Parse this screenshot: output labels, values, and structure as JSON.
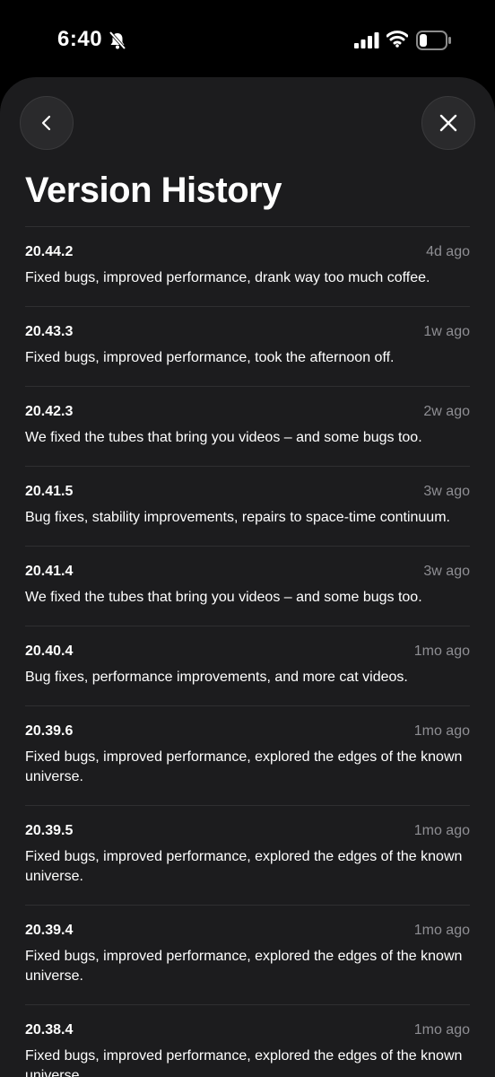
{
  "status_bar": {
    "time": "6:40",
    "icons": [
      "bell-slash-icon",
      "signal-icon",
      "wifi-icon",
      "battery-icon"
    ]
  },
  "header": {
    "back_icon": "chevron-left-icon",
    "close_icon": "close-icon",
    "title": "Version History"
  },
  "versions": [
    {
      "version": "20.44.2",
      "age": "4d ago",
      "notes": "Fixed bugs, improved performance, drank way too much coffee."
    },
    {
      "version": "20.43.3",
      "age": "1w ago",
      "notes": "Fixed bugs, improved performance, took the afternoon off."
    },
    {
      "version": "20.42.3",
      "age": "2w ago",
      "notes": "We fixed the tubes that bring you videos – and some bugs too."
    },
    {
      "version": "20.41.5",
      "age": "3w ago",
      "notes": "Bug fixes, stability improvements, repairs to space-time continuum."
    },
    {
      "version": "20.41.4",
      "age": "3w ago",
      "notes": "We fixed the tubes that bring you videos – and some bugs too."
    },
    {
      "version": "20.40.4",
      "age": "1mo ago",
      "notes": "Bug fixes, performance improvements, and more cat videos."
    },
    {
      "version": "20.39.6",
      "age": "1mo ago",
      "notes": "Fixed bugs, improved performance, explored the edges of the known universe."
    },
    {
      "version": "20.39.5",
      "age": "1mo ago",
      "notes": "Fixed bugs, improved performance, explored the edges of the known universe."
    },
    {
      "version": "20.39.4",
      "age": "1mo ago",
      "notes": "Fixed bugs, improved performance, explored the edges of the known universe."
    },
    {
      "version": "20.38.4",
      "age": "1mo ago",
      "notes": "Fixed bugs, improved performance, explored the edges of the known universe."
    }
  ],
  "colors": {
    "sheet_background": "#1c1c1e",
    "secondary_text": "#8e8e93",
    "divider": "#2f2f31"
  }
}
